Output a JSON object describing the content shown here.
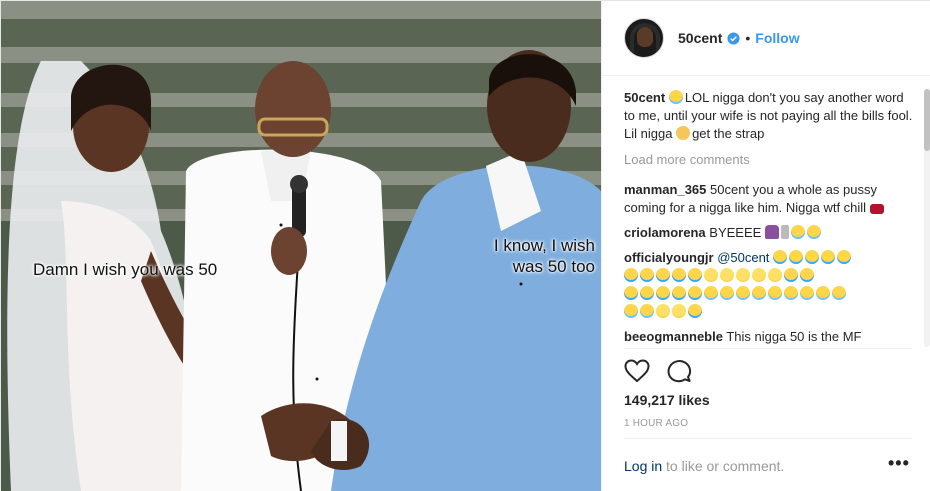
{
  "photo": {
    "caption_left": "Damn I wish you was 50",
    "caption_right_line1": "I know, I wish",
    "caption_right_line2": "was 50 too"
  },
  "header": {
    "username": "50cent",
    "separator": "•",
    "follow_label": "Follow",
    "verified_icon": "verified-badge-icon"
  },
  "comments": {
    "caption": {
      "user": "50cent",
      "text": "LOL nigga don't you say another word to me, until your wife is not paying all the bills fool. Lil n",
      "text_masked": "igga",
      "text_end": "get the strap"
    },
    "load_more": "Load more comments",
    "items": [
      {
        "user": "manman_365",
        "text": "50cent you a whole a",
        "masked1": "s",
        "text2": "p",
        "masked2": "u",
        "text3": "ssy coming for a n",
        "masked3": "i",
        "text4": "gga like him. N",
        "masked4": "i",
        "text5": "gga wtf chill"
      },
      {
        "user": "criolamorena",
        "text": "BYEEEE"
      },
      {
        "user": "officialyoungjr",
        "text": "@50cent"
      },
      {
        "user": "beeogmanneble",
        "text": "This nigga 50 is the MF"
      }
    ]
  },
  "actions": {
    "like_icon": "heart-icon",
    "comment_icon": "comment-bubble-icon"
  },
  "likes": "149,217 likes",
  "timestamp": "1 HOUR AGO",
  "footer": {
    "login_link": "Log in",
    "login_text": "to like or comment.",
    "more_label": "•••"
  },
  "colors": {
    "link": "#3897f0",
    "muted": "#999999",
    "text": "#262626",
    "suit": "#7faede"
  }
}
